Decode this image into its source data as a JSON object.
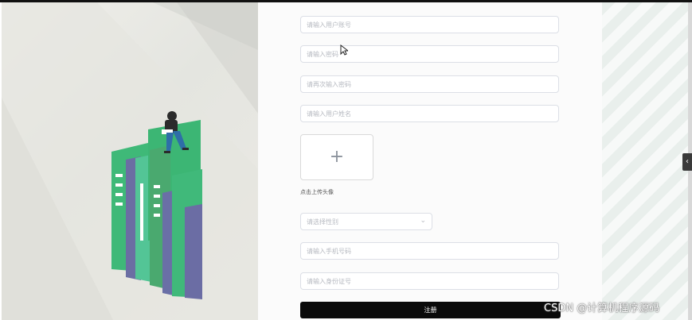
{
  "form": {
    "username_placeholder": "请输入用户账号",
    "password_placeholder": "请输入密码",
    "confirm_placeholder": "请再次输入密码",
    "name_placeholder": "请输入用户姓名",
    "upload_label": "点击上传头像",
    "gender_placeholder": "请选择性别",
    "phone_placeholder": "请输入手机号码",
    "idcard_placeholder": "请输入身份证号",
    "register_label": "注册"
  },
  "watermark": "CSDN @计算机程序源码",
  "icons": {
    "upload": "plus-icon",
    "select": "chevron-down-icon",
    "side_tab": "chevron-left-icon",
    "cursor": "mouse-cursor-icon"
  }
}
